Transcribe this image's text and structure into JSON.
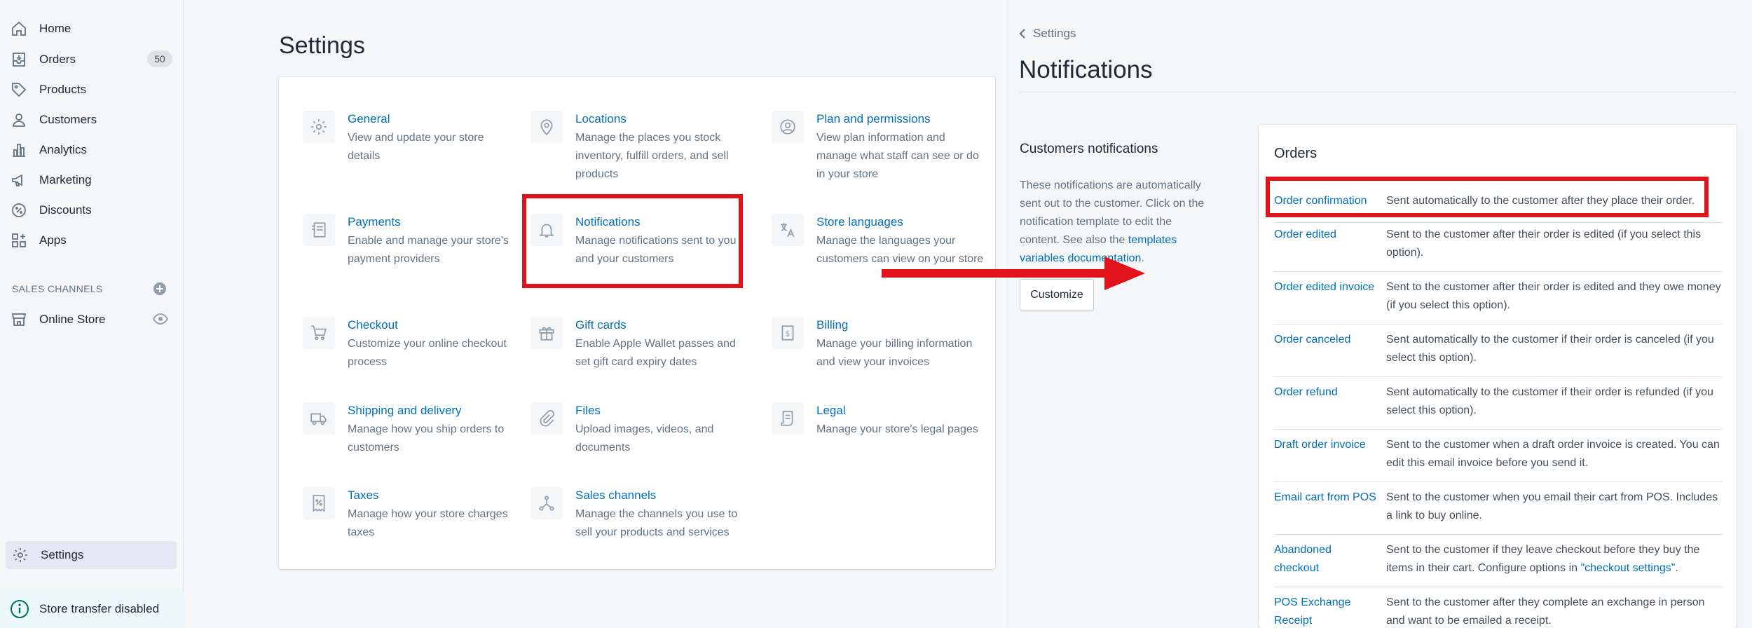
{
  "sidebar": {
    "items": [
      {
        "label": "Home",
        "icon": "home-icon"
      },
      {
        "label": "Orders",
        "icon": "orders-icon",
        "badge": "50"
      },
      {
        "label": "Products",
        "icon": "tag-icon"
      },
      {
        "label": "Customers",
        "icon": "person-icon"
      },
      {
        "label": "Analytics",
        "icon": "bar-chart-icon"
      },
      {
        "label": "Marketing",
        "icon": "megaphone-icon"
      },
      {
        "label": "Discounts",
        "icon": "discount-icon"
      },
      {
        "label": "Apps",
        "icon": "apps-icon"
      }
    ],
    "sales_channels_label": "SALES CHANNELS",
    "online_store_label": "Online Store",
    "settings_label": "Settings",
    "transfer_label": "Store transfer disabled"
  },
  "settings": {
    "title": "Settings",
    "items": [
      {
        "title": "General",
        "desc": "View and update your store details",
        "icon": "gear-icon"
      },
      {
        "title": "Locations",
        "desc": "Manage the places you stock inventory, fulfill orders, and sell products",
        "icon": "location-pin-icon"
      },
      {
        "title": "Plan and permissions",
        "desc": "View plan information and manage what staff can see or do in your store",
        "icon": "user-circle-icon"
      },
      {
        "title": "Payments",
        "desc": "Enable and manage your store's payment providers",
        "icon": "payments-icon"
      },
      {
        "title": "Notifications",
        "desc": "Manage notifications sent to you and your customers",
        "icon": "bell-icon"
      },
      {
        "title": "Store languages",
        "desc": "Manage the languages your customers can view on your store",
        "icon": "language-icon"
      },
      {
        "title": "Checkout",
        "desc": "Customize your online checkout process",
        "icon": "cart-icon"
      },
      {
        "title": "Gift cards",
        "desc": "Enable Apple Wallet passes and set gift card expiry dates",
        "icon": "gift-icon"
      },
      {
        "title": "Billing",
        "desc": "Manage your billing information and view your invoices",
        "icon": "billing-icon"
      },
      {
        "title": "Shipping and delivery",
        "desc": "Manage how you ship orders to customers",
        "icon": "truck-icon"
      },
      {
        "title": "Files",
        "desc": "Upload images, videos, and documents",
        "icon": "paperclip-icon"
      },
      {
        "title": "Legal",
        "desc": "Manage your store's legal pages",
        "icon": "legal-document-icon"
      },
      {
        "title": "Taxes",
        "desc": "Manage how your store charges taxes",
        "icon": "tax-receipt-icon"
      },
      {
        "title": "Sales channels",
        "desc": "Manage the channels you use to sell your products and services",
        "icon": "channels-icon"
      }
    ]
  },
  "notifications": {
    "back_label": "Settings",
    "title": "Notifications",
    "customers_heading": "Customers notifications",
    "customers_desc_prefix": "These notifications are automatically sent out to the customer. Click on the notification template to edit the content. See also the ",
    "customers_desc_link": "templates variables documentation",
    "customers_desc_suffix": ".",
    "customize_label": "Customize",
    "orders_heading": "Orders",
    "orders": [
      {
        "name": "Order confirmation",
        "desc": "Sent automatically to the customer after they place their order."
      },
      {
        "name": "Order edited",
        "desc": "Sent to the customer after their order is edited (if you select this option)."
      },
      {
        "name": "Order edited invoice",
        "desc": "Sent to the customer after their order is edited and they owe money (if you select this option)."
      },
      {
        "name": "Order canceled",
        "desc": "Sent automatically to the customer if their order is canceled (if you select this option)."
      },
      {
        "name": "Order refund",
        "desc": "Sent automatically to the customer if their order is refunded (if you select this option)."
      },
      {
        "name": "Draft order invoice",
        "desc": "Sent to the customer when a draft order invoice is created. You can edit this email invoice before you send it."
      },
      {
        "name": "Email cart from POS",
        "desc": "Sent to the customer when you email their cart from POS. Includes a link to buy online."
      },
      {
        "name": "Abandoned checkout",
        "desc_prefix": "Sent to the customer if they leave checkout before they buy the items in their cart. Configure options in ",
        "desc_link": "\"checkout settings\"",
        "desc_suffix": "."
      },
      {
        "name": "POS Exchange Receipt",
        "desc": "Sent to the customer after they complete an exchange in person and want to be emailed a receipt."
      }
    ]
  },
  "colors": {
    "link": "#006fbb",
    "highlight": "#e0131a",
    "text": "#212b36",
    "muted": "#637381"
  }
}
